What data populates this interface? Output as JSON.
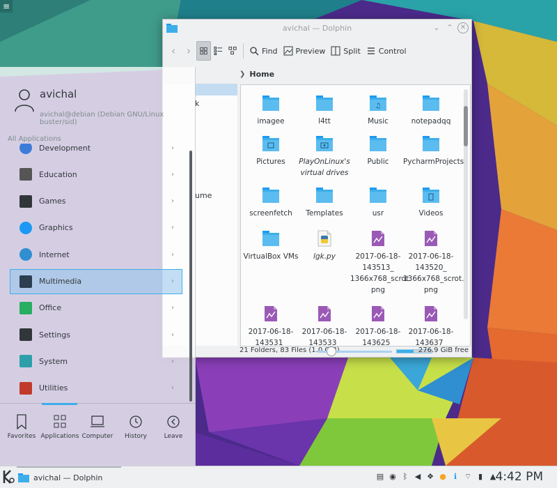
{
  "desktop": {
    "toolbox_icon": "hamburger-icon"
  },
  "dolphin": {
    "title": "avichal — Dolphin",
    "toolbar": {
      "find": "Find",
      "preview": "Preview",
      "split": "Split",
      "control": "Control"
    },
    "places_fragments": [
      "k",
      "ume"
    ],
    "breadcrumb": "Home",
    "files": [
      {
        "name": "imagee",
        "icon": "folder"
      },
      {
        "name": "l4tt",
        "icon": "folder"
      },
      {
        "name": "Music",
        "icon": "folder-music"
      },
      {
        "name": "notepadqq",
        "icon": "folder"
      },
      {
        "name": "Pictures",
        "icon": "folder-pictures"
      },
      {
        "name": "PlayOnLinux's virtual drives",
        "icon": "folder-link",
        "italic": true
      },
      {
        "name": "Public",
        "icon": "folder"
      },
      {
        "name": "PycharmProjects",
        "icon": "folder"
      },
      {
        "name": "screenfetch",
        "icon": "folder"
      },
      {
        "name": "Templates",
        "icon": "folder"
      },
      {
        "name": "usr",
        "icon": "folder"
      },
      {
        "name": "Videos",
        "icon": "folder-videos"
      },
      {
        "name": "VirtualBox VMs",
        "icon": "folder"
      },
      {
        "name": "lgk.py",
        "icon": "python-file",
        "italic": true
      },
      {
        "name": "2017-06-18-143513_1366x768_scrot.png",
        "lines": [
          "2017-06-18-",
          "143513_",
          "1366x768_scrot.",
          "png"
        ],
        "icon": "image-file"
      },
      {
        "name": "2017-06-18-143520_1366x768_scrot.png",
        "lines": [
          "2017-06-18-",
          "143520_",
          "1366x768_scrot.",
          "png"
        ],
        "icon": "image-file"
      },
      {
        "name": "2017-06-18-143531",
        "lines": [
          "2017-06-18-",
          "143531_"
        ],
        "icon": "image-file"
      },
      {
        "name": "2017-06-18-143533",
        "lines": [
          "2017-06-18-",
          "143533_"
        ],
        "icon": "image-file"
      },
      {
        "name": "2017-06-18-143625",
        "lines": [
          "2017-06-18-",
          "143625_"
        ],
        "icon": "image-file"
      },
      {
        "name": "2017-06-18-143637",
        "lines": [
          "2017-06-18-",
          "143637_"
        ],
        "icon": "image-file"
      }
    ],
    "status": {
      "summary": "21 Folders, 83 Files (1.0 GiB)",
      "free": "276.9 GiB free"
    }
  },
  "launcher": {
    "user_name": "avichal",
    "user_host": "avichal@debian (Debian GNU/Linux buster/sid)",
    "section_label": "All Applications",
    "categories": [
      {
        "label": "Development",
        "icon": "development-icon"
      },
      {
        "label": "Education",
        "icon": "education-icon"
      },
      {
        "label": "Games",
        "icon": "games-icon"
      },
      {
        "label": "Graphics",
        "icon": "graphics-icon"
      },
      {
        "label": "Internet",
        "icon": "internet-icon"
      },
      {
        "label": "Multimedia",
        "icon": "multimedia-icon",
        "selected": true
      },
      {
        "label": "Office",
        "icon": "office-icon"
      },
      {
        "label": "Settings",
        "icon": "settings-icon"
      },
      {
        "label": "System",
        "icon": "system-icon"
      },
      {
        "label": "Utilities",
        "icon": "utilities-icon"
      }
    ],
    "tabs": [
      {
        "label": "Favorites",
        "icon": "bookmark-icon"
      },
      {
        "label": "Applications",
        "icon": "applications-grid-icon"
      },
      {
        "label": "Computer",
        "icon": "computer-icon"
      },
      {
        "label": "History",
        "icon": "history-icon"
      },
      {
        "label": "Leave",
        "icon": "leave-icon"
      }
    ]
  },
  "panel": {
    "task_label": "avichal — Dolphin",
    "clock": "4:42 PM"
  }
}
